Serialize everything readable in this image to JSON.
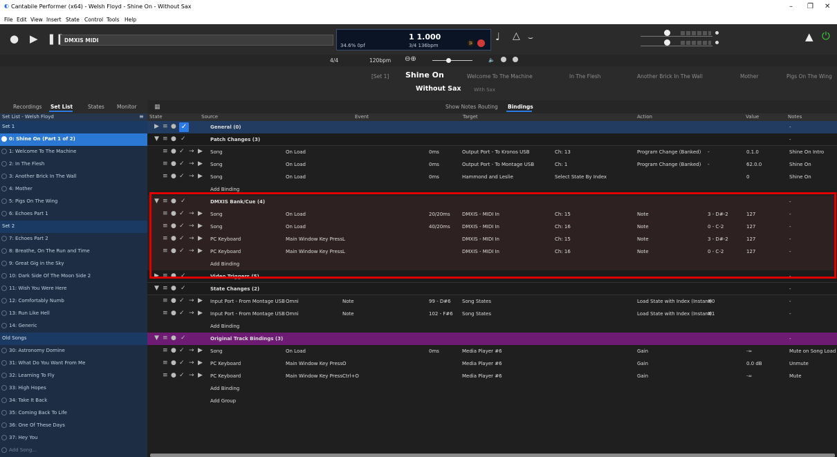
{
  "window": {
    "title": "Cantabile Performer (x64) - Welsh Floyd - Shine On - Without Sax",
    "minimize": "–",
    "maximize": "❐",
    "close": "✕"
  },
  "menu": [
    "File",
    "Edit",
    "View",
    "Insert",
    "State",
    "Control",
    "Tools",
    "Help"
  ],
  "toolbar": {
    "song_name": "DMXIS MIDI",
    "cpu": "34.6% 0pf",
    "position": "1 1.000",
    "signature": "3/4 136bpm"
  },
  "transport": {
    "time_sig": "4/4",
    "tempo": "120bpm"
  },
  "songs": {
    "set_label": "[Set 1]",
    "current": "Shine On",
    "list": [
      "Welcome To The Machine",
      "In The Flesh",
      "Another Brick In The Wall",
      "Mother",
      "Pigs On The Wing"
    ]
  },
  "parts": {
    "current": "Without Sax",
    "other": "With Sax"
  },
  "left_tabs": [
    "Recordings",
    "Set List",
    "States",
    "Monitor"
  ],
  "setlist": {
    "title": "Set List - Welsh Floyd",
    "items": [
      {
        "label": "Set 1",
        "type": "header"
      },
      {
        "label": "0: Shine On (Part 1 of 2)",
        "type": "selected"
      },
      {
        "label": "1: Welcome To The Machine",
        "type": "item"
      },
      {
        "label": "2: In The Flesh",
        "type": "item"
      },
      {
        "label": "3: Another Brick In The Wall",
        "type": "item"
      },
      {
        "label": "4: Mother",
        "type": "item"
      },
      {
        "label": "5: Pigs On The Wing",
        "type": "item"
      },
      {
        "label": "6: Echoes Part 1",
        "type": "item"
      },
      {
        "label": "Set 2",
        "type": "header"
      },
      {
        "label": "7: Echoes Part 2",
        "type": "item"
      },
      {
        "label": "8: Breathe, On The Run and Time",
        "type": "item"
      },
      {
        "label": "9: Great Gig in the Sky",
        "type": "item"
      },
      {
        "label": "10: Dark Side Of The Moon Side 2",
        "type": "item"
      },
      {
        "label": "11: Wish You Were Here",
        "type": "item"
      },
      {
        "label": "12: Comfortably Numb",
        "type": "item"
      },
      {
        "label": "13: Run Like Hell",
        "type": "item"
      },
      {
        "label": "14: Generic",
        "type": "item"
      },
      {
        "label": "Old Songs",
        "type": "header"
      },
      {
        "label": "30: Astronomy Domine",
        "type": "item"
      },
      {
        "label": "31: What Do You Want From Me",
        "type": "item"
      },
      {
        "label": "32: Learning To Fly",
        "type": "item"
      },
      {
        "label": "33: High Hopes",
        "type": "item"
      },
      {
        "label": "34: Take It Back",
        "type": "item"
      },
      {
        "label": "35: Coming Back To Life",
        "type": "item"
      },
      {
        "label": "36: One Of These Days",
        "type": "item"
      },
      {
        "label": "37: Hey You",
        "type": "item"
      },
      {
        "label": "Add Song...",
        "type": "add"
      }
    ]
  },
  "right_tabs": [
    "Show Notes",
    "Routing",
    "Bindings"
  ],
  "columns": [
    "State",
    "Source",
    "Event",
    "Target",
    "Action",
    "Value",
    "Notes"
  ],
  "rows": [
    {
      "kind": "group",
      "style": "grpsel",
      "expand": "▶",
      "name": "General (0)",
      "notes": "-"
    },
    {
      "kind": "group",
      "style": "grp",
      "expand": "▼",
      "name": "Patch Changes (3)",
      "notes": "-"
    },
    {
      "kind": "binding",
      "style": "",
      "source": "Song",
      "source2": "On Load",
      "event": "",
      "delay": "0ms",
      "target": "Output Port - To Kronos USB",
      "target2": "Ch: 13",
      "action": "Program Change (Banked)",
      "action2": "-",
      "value": "0.1.0",
      "notes": "Shine On Intro"
    },
    {
      "kind": "binding",
      "style": "",
      "source": "Song",
      "source2": "On Load",
      "event": "",
      "delay": "0ms",
      "target": "Output Port - To Montage USB",
      "target2": "Ch: 1",
      "action": "Program Change (Banked)",
      "action2": "-",
      "value": "62.0.0",
      "notes": "Shine On"
    },
    {
      "kind": "binding",
      "style": "",
      "source": "Song",
      "source2": "On Load",
      "event": "",
      "delay": "0ms",
      "target": "Hammond and Leslie",
      "target2": "Select State By Index",
      "action": "",
      "action2": "",
      "value": "0",
      "notes": "Shine On"
    },
    {
      "kind": "add",
      "style": "",
      "label": "Add Binding"
    },
    {
      "kind": "group",
      "style": "maroon",
      "expand": "▼",
      "name": "DMXIS Bank/Cue (4)",
      "notes": "-"
    },
    {
      "kind": "binding",
      "style": "maroon",
      "source": "Song",
      "source2": "On Load",
      "event": "",
      "delay": "20/20ms",
      "target": "DMXIS - MIDI In",
      "target2": "Ch: 15",
      "action": "Note",
      "action2": "3 - D#-2",
      "value": "127",
      "notes": "-"
    },
    {
      "kind": "binding",
      "style": "maroon",
      "source": "Song",
      "source2": "On Load",
      "event": "",
      "delay": "40/20ms",
      "target": "DMXIS - MIDI In",
      "target2": "Ch: 16",
      "action": "Note",
      "action2": "0 - C-2",
      "value": "127",
      "notes": "-"
    },
    {
      "kind": "binding",
      "style": "maroon",
      "source": "PC Keyboard",
      "source2": "Main Window Key Press",
      "event": "L",
      "delay": "",
      "target": "DMXIS - MIDI In",
      "target2": "Ch: 15",
      "action": "Note",
      "action2": "3 - D#-2",
      "value": "127",
      "notes": "-"
    },
    {
      "kind": "binding",
      "style": "maroon",
      "source": "PC Keyboard",
      "source2": "Main Window Key Press",
      "event": "L",
      "delay": "",
      "target": "DMXIS - MIDI In",
      "target2": "Ch: 16",
      "action": "Note",
      "action2": "0 - C-2",
      "value": "127",
      "notes": "-"
    },
    {
      "kind": "add",
      "style": "maroon",
      "label": "Add Binding"
    },
    {
      "kind": "group",
      "style": "grp",
      "expand": "▶",
      "name": "Video Triggers (5)",
      "notes": "-"
    },
    {
      "kind": "group",
      "style": "grp",
      "expand": "▼",
      "name": "State Changes (2)",
      "notes": "-"
    },
    {
      "kind": "binding",
      "style": "",
      "source": "Input Port - From Montage USB",
      "source2": "Omni",
      "event": "Note",
      "delay": "99 - D#6",
      "target": "Song States",
      "target2": "",
      "action": "Load State with Index (Instant)",
      "action2": "#0",
      "value": "",
      "notes": "-"
    },
    {
      "kind": "binding",
      "style": "",
      "source": "Input Port - From Montage USB",
      "source2": "Omni",
      "event": "Note",
      "delay": "102 - F#6",
      "target": "Song States",
      "target2": "",
      "action": "Load State with Index (Instant)",
      "action2": "#1",
      "value": "",
      "notes": "-"
    },
    {
      "kind": "add",
      "style": "",
      "label": "Add Binding"
    },
    {
      "kind": "group",
      "style": "grppur",
      "expand": "▼",
      "name": "Original Track Bindings (3)",
      "notes": "-"
    },
    {
      "kind": "binding",
      "style": "",
      "source": "Song",
      "source2": "On Load",
      "event": "",
      "delay": "0ms",
      "target": "Media Player #6",
      "target2": "",
      "action": "Gain",
      "action2": "",
      "value": "-∞",
      "notes": "Mute on Song Load"
    },
    {
      "kind": "binding",
      "style": "",
      "source": "PC Keyboard",
      "source2": "Main Window Key Press",
      "event": "O",
      "delay": "",
      "target": "Media Player #6",
      "target2": "",
      "action": "Gain",
      "action2": "",
      "value": "0.0 dB",
      "notes": "Unmute"
    },
    {
      "kind": "binding",
      "style": "",
      "source": "PC Keyboard",
      "source2": "Main Window Key Press",
      "event": "Ctrl+O",
      "delay": "",
      "target": "Media Player #6",
      "target2": "",
      "action": "Gain",
      "action2": "",
      "value": "-∞",
      "notes": "Mute"
    },
    {
      "kind": "add",
      "style": "",
      "label": "Add Binding"
    },
    {
      "kind": "add",
      "style": "",
      "label": "Add Group"
    }
  ],
  "colors": {
    "accent": "#2c7be5",
    "highlight": "#e00000",
    "group_purple": "#6d1b73",
    "power": "#3ccb3c"
  }
}
